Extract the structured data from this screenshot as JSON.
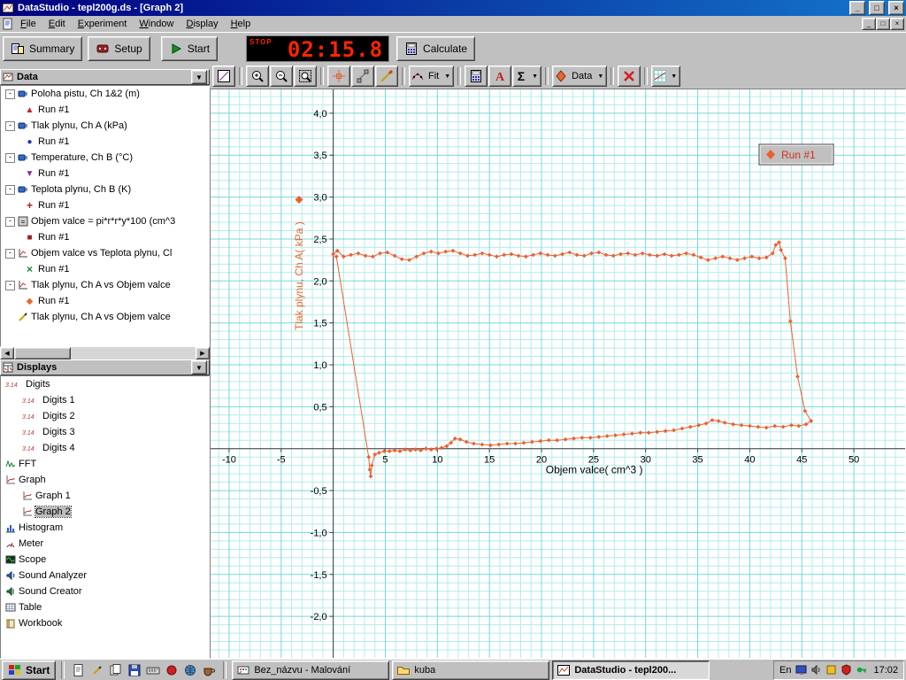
{
  "window": {
    "title": "DataStudio - tepl200g.ds - [Graph 2]",
    "menu": [
      "File",
      "Edit",
      "Experiment",
      "Window",
      "Display",
      "Help"
    ]
  },
  "icons": {
    "minimize": "_",
    "maximize": "□",
    "close": "×",
    "dropdown": "▼",
    "scroll_left": "◀",
    "scroll_right": "▶",
    "expand_open": "-"
  },
  "toolbar": {
    "summary": "Summary",
    "setup": "Setup",
    "start": "Start",
    "calculate": "Calculate"
  },
  "timer": {
    "stop": "STOP",
    "value": "02:15.8"
  },
  "graph_toolbar": {
    "buttons": [
      {
        "name": "scale-to-fit-button",
        "icon": "scalefit"
      },
      {
        "sep": true
      },
      {
        "name": "zoom-in-button",
        "icon": "zoomin"
      },
      {
        "name": "zoom-out-button",
        "icon": "zoomout"
      },
      {
        "name": "zoom-select-button",
        "icon": "zoomsel"
      },
      {
        "sep": true
      },
      {
        "name": "smart-tool-button",
        "icon": "smart"
      },
      {
        "name": "slope-tool-button",
        "icon": "slope"
      },
      {
        "name": "annotate-button",
        "icon": "noteline"
      },
      {
        "sep": true
      },
      {
        "name": "fit-menu-button",
        "icon": "fitline",
        "label": "Fit",
        "dropdown": true
      },
      {
        "sep": true
      },
      {
        "name": "calculator-button",
        "icon": "calc"
      },
      {
        "name": "text-tool-button",
        "icon": "textA"
      },
      {
        "name": "statistics-button",
        "icon": "sigma",
        "dropdown": true
      },
      {
        "sep": true
      },
      {
        "name": "data-menu-button",
        "icon": "diamond",
        "label": "Data",
        "dropdown": true
      },
      {
        "sep": true
      },
      {
        "name": "remove-button",
        "icon": "redx"
      },
      {
        "sep": true
      },
      {
        "name": "settings-button",
        "icon": "gridset",
        "dropdown": true
      }
    ]
  },
  "data_panel": {
    "title": "Data",
    "items": [
      {
        "label": "Poloha pistu, Ch 1&2 (m)",
        "icon": "sensor",
        "runs": [
          {
            "label": "Run #1",
            "marker": "triangle-up",
            "color": "#c82020"
          }
        ]
      },
      {
        "label": "Tlak plynu, Ch A (kPa)",
        "icon": "sensor",
        "runs": [
          {
            "label": "Run #1",
            "marker": "circle",
            "color": "#2030c0"
          }
        ]
      },
      {
        "label": "Temperature, Ch B (°C)",
        "icon": "sensor",
        "runs": [
          {
            "label": "Run #1",
            "marker": "triangle-down",
            "color": "#8030a0"
          }
        ]
      },
      {
        "label": "Teplota plynu, Ch B (K)",
        "icon": "sensor",
        "runs": [
          {
            "label": "Run #1",
            "marker": "plus",
            "color": "#b02020"
          }
        ]
      },
      {
        "label": "Objem valce = pi*r*r*y*100 (cm^3",
        "icon": "calcicon",
        "runs": [
          {
            "label": "Run #1",
            "marker": "square",
            "color": "#a02020"
          }
        ]
      },
      {
        "label": "Objem valce vs Teplota plynu, Cl",
        "icon": "xy",
        "runs": [
          {
            "label": "Run #1",
            "marker": "x",
            "color": "#208030"
          }
        ]
      },
      {
        "label": "Tlak plynu, Ch A vs Objem valce",
        "icon": "xy",
        "runs": [
          {
            "label": "Run #1",
            "marker": "diamond",
            "color": "#e8682c"
          }
        ]
      },
      {
        "label": "Tlak plynu, Ch A vs Objem valce",
        "icon": "pencil",
        "runs": []
      }
    ]
  },
  "displays_panel": {
    "title": "Displays",
    "items": [
      {
        "label": "Digits",
        "icon": "digits",
        "children": [
          {
            "label": "Digits 1",
            "icon": "digits"
          },
          {
            "label": "Digits 2",
            "icon": "digits"
          },
          {
            "label": "Digits 3",
            "icon": "digits"
          },
          {
            "label": "Digits 4",
            "icon": "digits"
          }
        ]
      },
      {
        "label": "FFT",
        "icon": "fft"
      },
      {
        "label": "Graph",
        "icon": "graphicon",
        "children": [
          {
            "label": "Graph 1",
            "icon": "graphicon"
          },
          {
            "label": "Graph 2",
            "icon": "graphicon",
            "selected": true
          }
        ]
      },
      {
        "label": "Histogram",
        "icon": "histogram"
      },
      {
        "label": "Meter",
        "icon": "meter"
      },
      {
        "label": "Scope",
        "icon": "scope"
      },
      {
        "label": "Sound Analyzer",
        "icon": "sound"
      },
      {
        "label": "Sound Creator",
        "icon": "sound2"
      },
      {
        "label": "Table",
        "icon": "tableicon"
      },
      {
        "label": "Workbook",
        "icon": "workbook"
      }
    ]
  },
  "chart_data": {
    "type": "scatter",
    "title": "",
    "xlabel": "Objem valce( cm^3 )",
    "ylabel": "Tlak plynu, Ch A( kPa )",
    "ylabel_color": "#e8682c",
    "xlim": [
      -11.78,
      54.92
    ],
    "ylim": [
      -2.495,
      4.284
    ],
    "grid": {
      "minor_x": 1,
      "major_x": 5,
      "minor_y": 0.1,
      "major_y": 0.5,
      "minor_color": "#b2ecec",
      "major_color": "#74d8d8"
    },
    "axis_color": "#404040",
    "x_ticks": [
      {
        "v": -10,
        "t": "-10"
      },
      {
        "v": -5,
        "t": "-5"
      },
      {
        "v": 5,
        "t": "5"
      },
      {
        "v": 10,
        "t": "10"
      },
      {
        "v": 15,
        "t": "15"
      },
      {
        "v": 20,
        "t": "20"
      },
      {
        "v": 25,
        "t": "25"
      },
      {
        "v": 30,
        "t": "30"
      },
      {
        "v": 35,
        "t": "35"
      },
      {
        "v": 40,
        "t": "40"
      },
      {
        "v": 45,
        "t": "45"
      },
      {
        "v": 50,
        "t": "50"
      }
    ],
    "y_ticks": [
      {
        "v": 4,
        "t": "4,0"
      },
      {
        "v": 3.5,
        "t": "3,5"
      },
      {
        "v": 3,
        "t": "3,0"
      },
      {
        "v": 2.5,
        "t": "2,5"
      },
      {
        "v": 2,
        "t": "2,0"
      },
      {
        "v": 1.5,
        "t": "1,5"
      },
      {
        "v": 1,
        "t": "1,0"
      },
      {
        "v": 0.5,
        "t": "0,5"
      },
      {
        "v": -0.5,
        "t": "-0,5"
      },
      {
        "v": -1,
        "t": "-1,0"
      },
      {
        "v": -1.5,
        "t": "-1,5"
      },
      {
        "v": -2,
        "t": "-2,0"
      }
    ],
    "legend": {
      "label": "Run #1",
      "position": "top-right"
    },
    "series": [
      {
        "name": "Run #1",
        "color": "#ee5f2e",
        "marker": "diamond",
        "points": [
          [
            0,
            2.32
          ],
          [
            0.4,
            2.36
          ],
          [
            1,
            2.29
          ],
          [
            1.7,
            2.31
          ],
          [
            2.4,
            2.33
          ],
          [
            3.1,
            2.3
          ],
          [
            3.8,
            2.29
          ],
          [
            4.5,
            2.33
          ],
          [
            5.2,
            2.34
          ],
          [
            5.9,
            2.3
          ],
          [
            6.6,
            2.26
          ],
          [
            7.3,
            2.25
          ],
          [
            8,
            2.29
          ],
          [
            8.7,
            2.33
          ],
          [
            9.4,
            2.35
          ],
          [
            10.1,
            2.33
          ],
          [
            10.8,
            2.35
          ],
          [
            11.5,
            2.36
          ],
          [
            12.2,
            2.33
          ],
          [
            12.9,
            2.3
          ],
          [
            13.6,
            2.31
          ],
          [
            14.3,
            2.33
          ],
          [
            15,
            2.31
          ],
          [
            15.7,
            2.29
          ],
          [
            16.4,
            2.31
          ],
          [
            17.1,
            2.32
          ],
          [
            17.8,
            2.3
          ],
          [
            18.5,
            2.29
          ],
          [
            19.2,
            2.31
          ],
          [
            19.9,
            2.33
          ],
          [
            20.6,
            2.31
          ],
          [
            21.3,
            2.3
          ],
          [
            22,
            2.32
          ],
          [
            22.7,
            2.34
          ],
          [
            23.4,
            2.31
          ],
          [
            24.1,
            2.3
          ],
          [
            24.8,
            2.33
          ],
          [
            25.5,
            2.34
          ],
          [
            26.2,
            2.31
          ],
          [
            26.9,
            2.3
          ],
          [
            27.6,
            2.32
          ],
          [
            28.3,
            2.33
          ],
          [
            29,
            2.31
          ],
          [
            29.7,
            2.33
          ],
          [
            30.4,
            2.31
          ],
          [
            31.1,
            2.3
          ],
          [
            31.8,
            2.32
          ],
          [
            32.5,
            2.3
          ],
          [
            33.2,
            2.31
          ],
          [
            33.9,
            2.33
          ],
          [
            34.6,
            2.31
          ],
          [
            35.3,
            2.28
          ],
          [
            36,
            2.25
          ],
          [
            36.7,
            2.27
          ],
          [
            37.4,
            2.29
          ],
          [
            38.1,
            2.27
          ],
          [
            38.8,
            2.25
          ],
          [
            39.5,
            2.27
          ],
          [
            40.2,
            2.29
          ],
          [
            40.9,
            2.27
          ],
          [
            41.6,
            2.28
          ],
          [
            42.2,
            2.33
          ],
          [
            42.5,
            2.43
          ],
          [
            42.8,
            2.46
          ],
          [
            43,
            2.37
          ],
          [
            43.4,
            2.27
          ],
          [
            43.9,
            1.52
          ],
          [
            44.6,
            0.86
          ],
          [
            45.3,
            0.45
          ],
          [
            45.9,
            0.33
          ],
          [
            45.4,
            0.29
          ],
          [
            44.7,
            0.27
          ],
          [
            44,
            0.28
          ],
          [
            43.2,
            0.26
          ],
          [
            42.4,
            0.27
          ],
          [
            41.6,
            0.25
          ],
          [
            40.8,
            0.26
          ],
          [
            40,
            0.27
          ],
          [
            39.2,
            0.28
          ],
          [
            38.4,
            0.29
          ],
          [
            37.6,
            0.31
          ],
          [
            37,
            0.33
          ],
          [
            36.4,
            0.34
          ],
          [
            35.8,
            0.3
          ],
          [
            35.1,
            0.28
          ],
          [
            34.3,
            0.26
          ],
          [
            33.5,
            0.24
          ],
          [
            32.7,
            0.22
          ],
          [
            31.9,
            0.21
          ],
          [
            31.1,
            0.2
          ],
          [
            30.3,
            0.19
          ],
          [
            29.5,
            0.19
          ],
          [
            28.7,
            0.18
          ],
          [
            27.9,
            0.17
          ],
          [
            27.1,
            0.16
          ],
          [
            26.3,
            0.15
          ],
          [
            25.5,
            0.14
          ],
          [
            24.7,
            0.13
          ],
          [
            23.9,
            0.13
          ],
          [
            23.1,
            0.12
          ],
          [
            22.3,
            0.11
          ],
          [
            21.5,
            0.1
          ],
          [
            20.7,
            0.1
          ],
          [
            19.9,
            0.09
          ],
          [
            19.1,
            0.08
          ],
          [
            18.3,
            0.07
          ],
          [
            17.5,
            0.06
          ],
          [
            16.7,
            0.06
          ],
          [
            15.9,
            0.05
          ],
          [
            15.1,
            0.04
          ],
          [
            14.3,
            0.05
          ],
          [
            13.5,
            0.06
          ],
          [
            12.8,
            0.08
          ],
          [
            12.2,
            0.11
          ],
          [
            11.7,
            0.12
          ],
          [
            11.3,
            0.07
          ],
          [
            10.9,
            0.03
          ],
          [
            10.4,
            0.01
          ],
          [
            9.9,
            0
          ],
          [
            9.4,
            -0.01
          ],
          [
            8.9,
            0
          ],
          [
            8.4,
            -0.02
          ],
          [
            7.9,
            -0.01
          ],
          [
            7.4,
            -0.02
          ],
          [
            6.9,
            -0.01
          ],
          [
            6.4,
            -0.03
          ],
          [
            5.9,
            -0.02
          ],
          [
            5.4,
            -0.03
          ],
          [
            4.9,
            -0.03
          ],
          [
            4.4,
            -0.05
          ],
          [
            4,
            -0.07
          ],
          [
            3.7,
            -0.2
          ],
          [
            3.6,
            -0.33
          ],
          [
            3.5,
            -0.25
          ],
          [
            3.4,
            -0.1
          ],
          [
            0.3,
            2.29
          ]
        ]
      }
    ]
  },
  "taskbar": {
    "start_label": "Start",
    "quicklaunch": [
      "page",
      "pencil",
      "pages",
      "floppy",
      "keyb",
      "redball",
      "globe",
      "cup"
    ],
    "tasks": [
      {
        "label": "Bez_názvu - Malování",
        "icon": "paint",
        "active": false
      },
      {
        "label": "kuba",
        "icon": "folder",
        "active": false
      },
      {
        "label": "DataStudio - tepl200...",
        "icon": "dslogo",
        "active": true
      }
    ],
    "tray": {
      "lang": "En",
      "icons": [
        "monitor",
        "speaker",
        "yellowdoc",
        "redshield",
        "greenkey"
      ],
      "time": "17:02"
    }
  }
}
